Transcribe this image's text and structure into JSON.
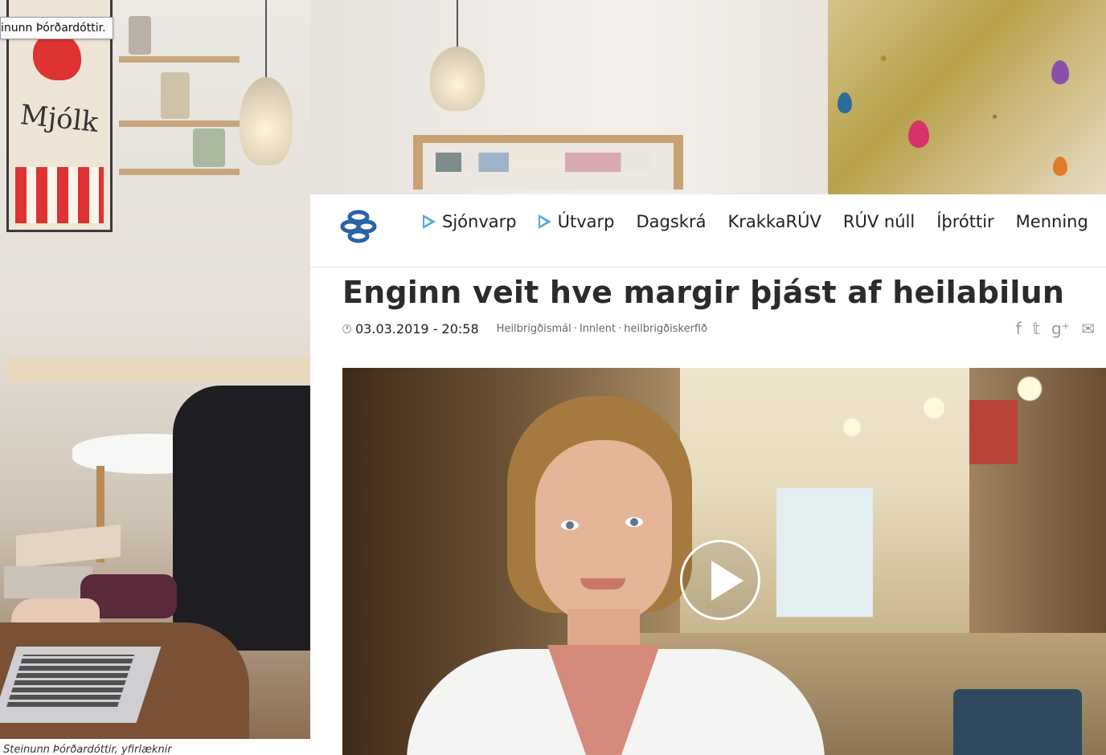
{
  "background": {
    "tooltip_text": "inunn Þórðardóttir.",
    "poster_text": "Mjólk",
    "caption_text": "Steinunn Þórðardóttir, yfirlæknir"
  },
  "nav": {
    "items": [
      {
        "label": "Sjónvarp",
        "has_play_icon": true
      },
      {
        "label": "Útvarp",
        "has_play_icon": true
      },
      {
        "label": "Dagskrá",
        "has_play_icon": false
      },
      {
        "label": "KrakkaRÚV",
        "has_play_icon": false
      },
      {
        "label": "RÚV núll",
        "has_play_icon": false
      },
      {
        "label": "Íþróttir",
        "has_play_icon": false
      },
      {
        "label": "Menning",
        "has_play_icon": false
      }
    ],
    "accent_color": "#5aa8da",
    "logo_color": "#2b62a8"
  },
  "article": {
    "headline": "Enginn veit hve margir þjást af heilabilun",
    "date": "03.03.2019 - 20:58",
    "tags": [
      "Heilbrigðismál",
      "Innlent",
      "heilbrigðiskerfið"
    ],
    "share_icons": [
      "facebook-icon",
      "twitter-icon",
      "google-plus-icon",
      "mail-icon"
    ],
    "share_glyphs": [
      "f",
      "𝕥",
      "g⁺",
      "✉"
    ]
  },
  "video": {
    "play_icon": "play-icon"
  }
}
